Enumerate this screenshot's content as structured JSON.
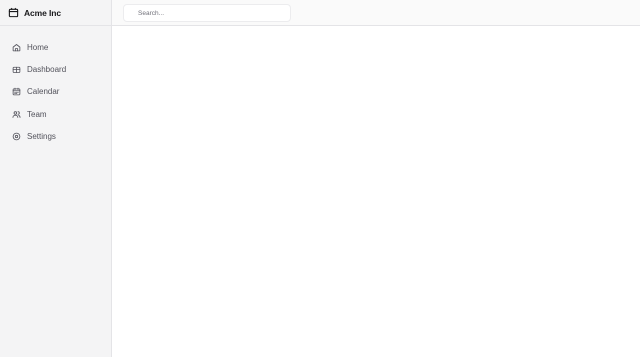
{
  "brand": {
    "name": "Acme Inc",
    "icon": "package-icon"
  },
  "search": {
    "placeholder": "Search...",
    "value": ""
  },
  "sidebar": {
    "items": [
      {
        "label": "Home",
        "icon": "home-icon"
      },
      {
        "label": "Dashboard",
        "icon": "dashboard-icon"
      },
      {
        "label": "Calendar",
        "icon": "calendar-icon"
      },
      {
        "label": "Team",
        "icon": "team-icon"
      },
      {
        "label": "Settings",
        "icon": "settings-icon"
      }
    ]
  },
  "colors": {
    "sidebar_bg": "#f4f4f5",
    "topbar_bg": "#fafafa",
    "border": "#e4e4e7",
    "text_muted": "#52525b",
    "text_strong": "#18181b"
  }
}
